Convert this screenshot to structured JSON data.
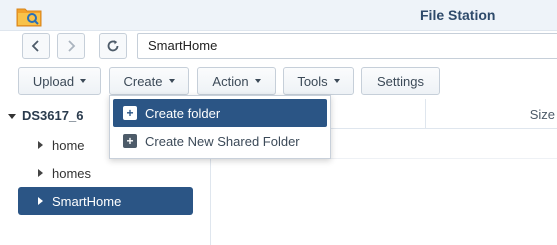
{
  "window": {
    "title": "File Station"
  },
  "nav": {
    "path": "SmartHome"
  },
  "toolbar": {
    "upload": "Upload",
    "create": "Create",
    "action": "Action",
    "tools": "Tools",
    "settings": "Settings"
  },
  "tree": {
    "root": "DS3617_6",
    "items": [
      {
        "label": "home"
      },
      {
        "label": "homes"
      },
      {
        "label": "SmartHome"
      }
    ]
  },
  "list": {
    "size_header": "Size"
  },
  "create_menu": {
    "items": [
      {
        "label": "Create folder"
      },
      {
        "label": "Create New Shared Folder"
      }
    ]
  },
  "colors": {
    "accent": "#2b5585",
    "titlebar": "#eef3f9"
  }
}
